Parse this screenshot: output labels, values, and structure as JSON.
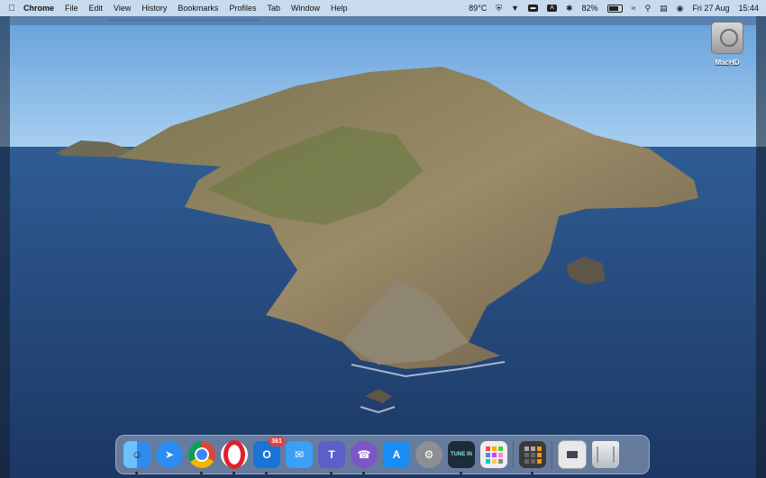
{
  "menubar": {
    "app_name": "Chrome",
    "menus": [
      "File",
      "Edit",
      "View",
      "History",
      "Bookmarks",
      "Profiles",
      "Tab",
      "Window",
      "Help"
    ],
    "temperature": "89°C",
    "battery": "82%",
    "date": "Fri 27 Aug",
    "time": "15:44"
  },
  "window": {
    "title_fragment": "...................................................................."
  },
  "desktop": {
    "drive_label": "MacHD"
  },
  "dock": {
    "items": [
      {
        "name": "finder",
        "label": "",
        "color": "#2e8bf0"
      },
      {
        "name": "safari",
        "label": "",
        "color": "#2d8cf0"
      },
      {
        "name": "chrome",
        "label": "",
        "color": "#ffffff"
      },
      {
        "name": "opera",
        "label": "",
        "color": "#ffffff"
      },
      {
        "name": "outlook",
        "label": "O",
        "color": "#1a73d6",
        "badge": "361"
      },
      {
        "name": "mail",
        "label": "✉",
        "color": "#3aa0f5"
      },
      {
        "name": "teams",
        "label": "T",
        "color": "#5b5fc7"
      },
      {
        "name": "viber",
        "label": "☎",
        "color": "#7d55c7"
      },
      {
        "name": "app-store",
        "label": "A",
        "color": "#1a8cf5"
      },
      {
        "name": "system-preferences",
        "label": "⚙",
        "color": "#8d8f93"
      },
      {
        "name": "tunein",
        "label": "TUNE IN",
        "color": "#1c2b3a"
      },
      {
        "name": "launchpad",
        "label": "",
        "color": "#eeeeee"
      },
      {
        "name": "calculator",
        "label": "",
        "color": "#3a3a3a"
      },
      {
        "name": "preview-file",
        "label": "",
        "color": "#e8e8e8"
      },
      {
        "name": "trash",
        "label": "",
        "color": "#d0d4d8"
      }
    ]
  }
}
